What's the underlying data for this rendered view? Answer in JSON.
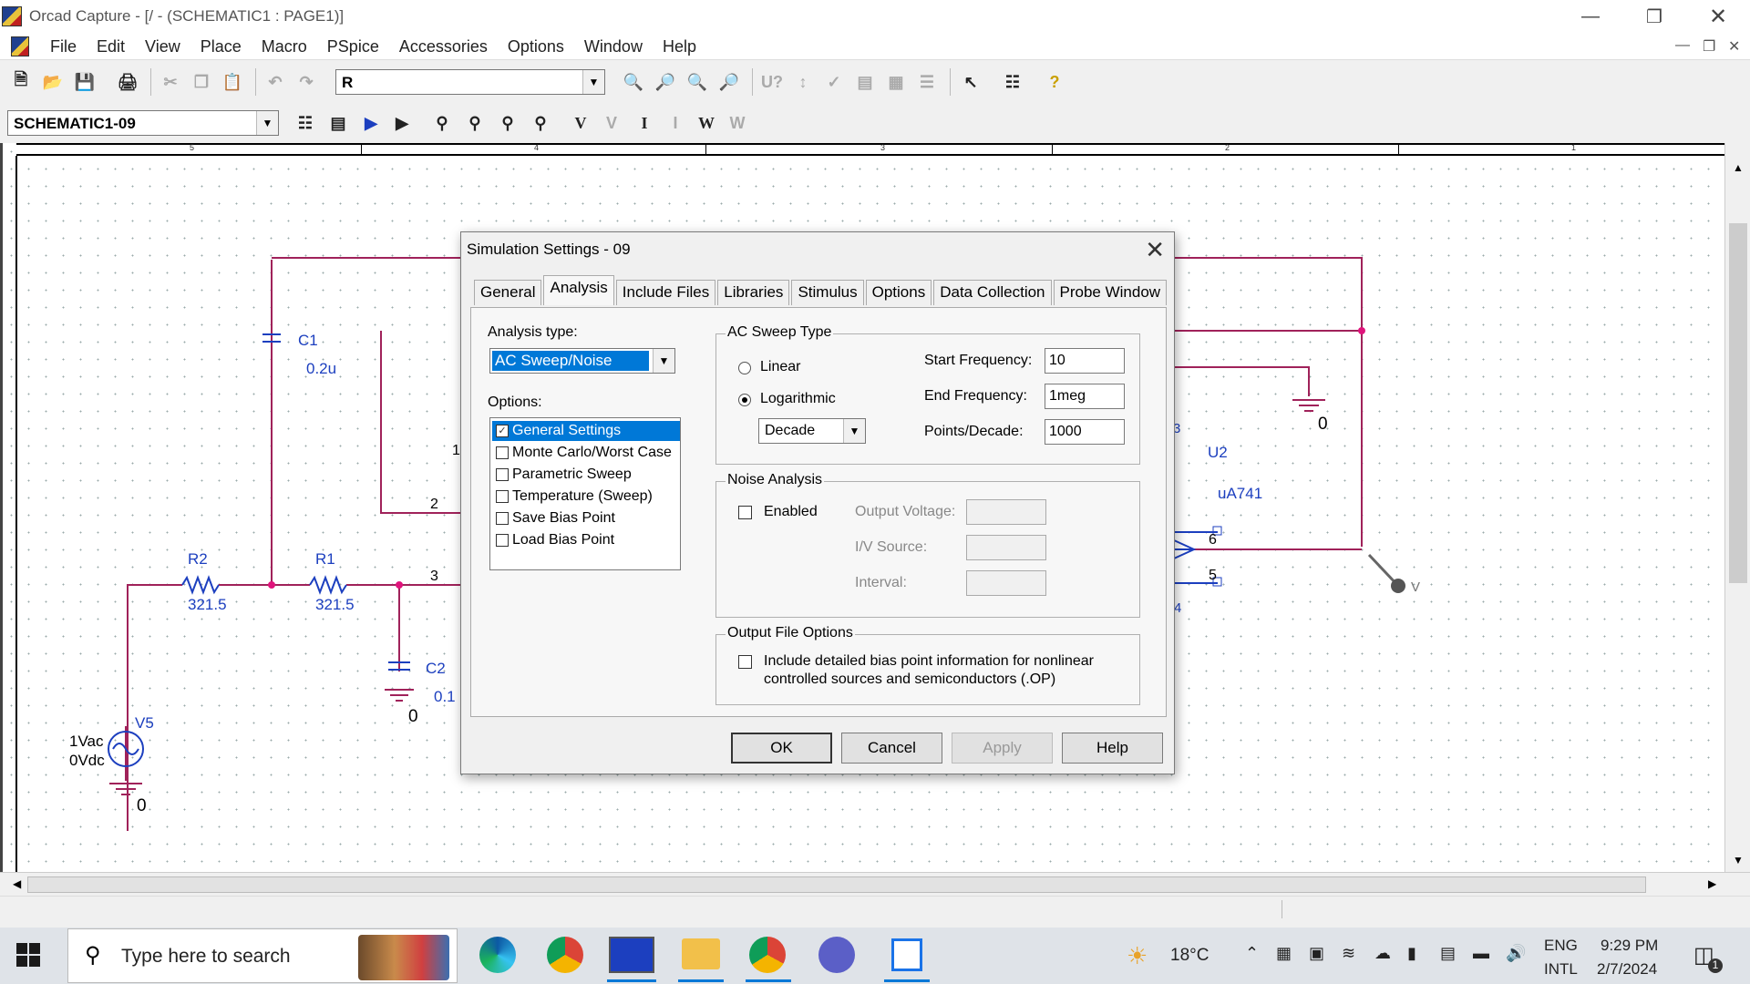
{
  "window": {
    "title": "Orcad Capture - [/ - (SCHEMATIC1 : PAGE1)]"
  },
  "menu": [
    "File",
    "Edit",
    "View",
    "Place",
    "Macro",
    "PSpice",
    "Accessories",
    "Options",
    "Window",
    "Help"
  ],
  "toolbar": {
    "part_combo": "R",
    "profile_combo": "SCHEMATIC1-09"
  },
  "ruler": [
    "5",
    "4",
    "3",
    "2",
    "1"
  ],
  "schematic": {
    "c1_name": "C1",
    "c1_value": "0.2u",
    "c2_name": "C2",
    "c2_value": "0.1",
    "r2_name": "R2",
    "r2_value": "321.5",
    "r1_name": "R1",
    "r1_value": "321.5",
    "v5_name": "V5",
    "v5_ac": "1Vac",
    "v5_dc": "0Vdc",
    "u2_name": "U2",
    "u2_part": "uA741",
    "gnd": "0",
    "pin_2": "2",
    "pin_3": "3",
    "pin_1": "1",
    "pin_6": "6",
    "pin_5": "5",
    "pin_3r": "3",
    "pin_4": "4",
    "probe": "V"
  },
  "dialog": {
    "title": "Simulation Settings - 09",
    "tabs": [
      "General",
      "Analysis",
      "Include Files",
      "Libraries",
      "Stimulus",
      "Options",
      "Data Collection",
      "Probe Window"
    ],
    "analysis_type_label": "Analysis type:",
    "analysis_type_value": "AC Sweep/Noise",
    "options_label": "Options:",
    "options": [
      {
        "label": "General Settings",
        "checked": true
      },
      {
        "label": "Monte Carlo/Worst Case",
        "checked": false
      },
      {
        "label": "Parametric Sweep",
        "checked": false
      },
      {
        "label": "Temperature (Sweep)",
        "checked": false
      },
      {
        "label": "Save Bias Point",
        "checked": false
      },
      {
        "label": "Load Bias Point",
        "checked": false
      }
    ],
    "ac_sweep": {
      "group_title": "AC Sweep Type",
      "linear": "Linear",
      "logarithmic": "Logarithmic",
      "log_unit": "Decade",
      "start_label": "Start Frequency:",
      "start_value": "10",
      "end_label": "End Frequency:",
      "end_value": "1meg",
      "points_label": "Points/Decade:",
      "points_value": "1000"
    },
    "noise": {
      "group_title": "Noise Analysis",
      "enabled": "Enabled",
      "output_voltage": "Output Voltage:",
      "iv_source": "I/V Source:",
      "interval": "Interval:"
    },
    "output_file": {
      "group_title": "Output File Options",
      "line1": "Include detailed bias point information for nonlinear",
      "line2": "controlled sources and semiconductors (.OP)"
    },
    "buttons": {
      "ok": "OK",
      "cancel": "Cancel",
      "apply": "Apply",
      "help": "Help"
    }
  },
  "taskbar": {
    "search_placeholder": "Type here to search",
    "weather": "18°C",
    "lang1": "ENG",
    "lang2": "INTL",
    "time": "9:29 PM",
    "date": "2/7/2024",
    "notif_count": "1"
  },
  "colors": {
    "wire": "#a0225a",
    "part": "#1c3fbf",
    "accent": "#0078d7"
  }
}
